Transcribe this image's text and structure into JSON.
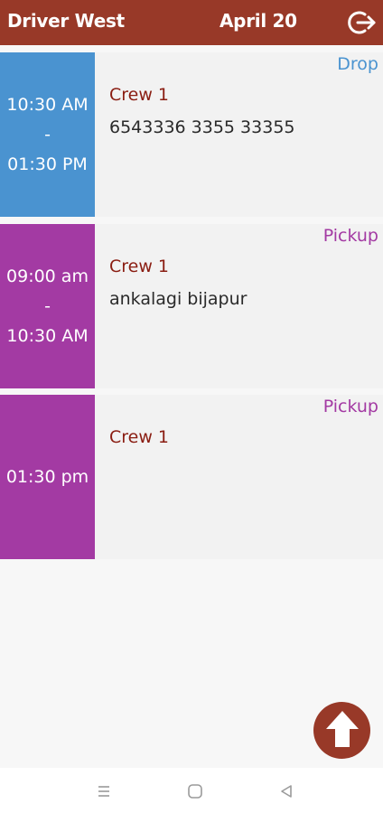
{
  "header": {
    "title": "Driver West",
    "date": "April 20",
    "logout_icon": "logout-icon"
  },
  "colors": {
    "header_bg": "#983928",
    "drop": "#4a93d0",
    "pickup": "#a33aa3",
    "crew_text": "#8a1d12"
  },
  "trips": [
    {
      "time_start": "10:30 AM",
      "separator": "-",
      "time_end": "01:30 PM",
      "type": "Drop",
      "crew": "Crew 1",
      "address": "6543336 3355 33355"
    },
    {
      "time_start": "09:00 am",
      "separator": "-",
      "time_end": "10:30 AM",
      "type": "Pickup",
      "crew": "Crew 1",
      "address": "ankalagi bijapur"
    },
    {
      "time_start": "01:30 pm",
      "type": "Pickup",
      "crew": "Crew 1"
    }
  ],
  "fab": {
    "icon": "arrow-up-icon"
  },
  "navbar": {
    "menu_icon": "menu-icon",
    "home_icon": "home-icon",
    "back_icon": "back-icon"
  }
}
